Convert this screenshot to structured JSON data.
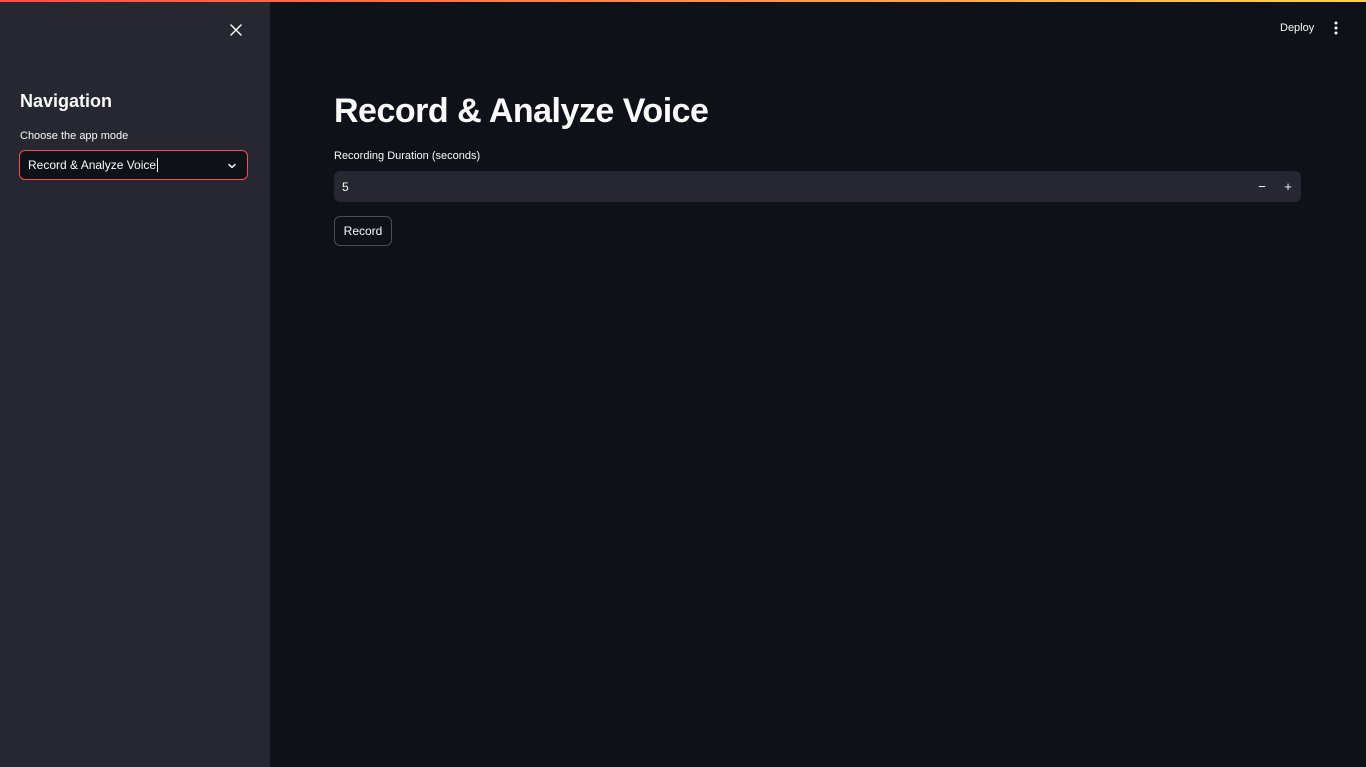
{
  "sidebar": {
    "close_icon": "close-icon",
    "title": "Navigation",
    "select_label": "Choose the app mode",
    "select_value": "Record & Analyze Voice",
    "select_icon": "chevron-down-icon"
  },
  "header": {
    "deploy_label": "Deploy",
    "menu_icon": "more-vertical-icon"
  },
  "main": {
    "title": "Record & Analyze Voice",
    "duration_label": "Recording Duration (seconds)",
    "duration_value": "5",
    "minus_label": "−",
    "plus_label": "+",
    "record_label": "Record"
  },
  "colors": {
    "background": "#0e1117",
    "sidebar": "#262730",
    "accent": "#ff4b4b",
    "text": "#fafafa"
  }
}
